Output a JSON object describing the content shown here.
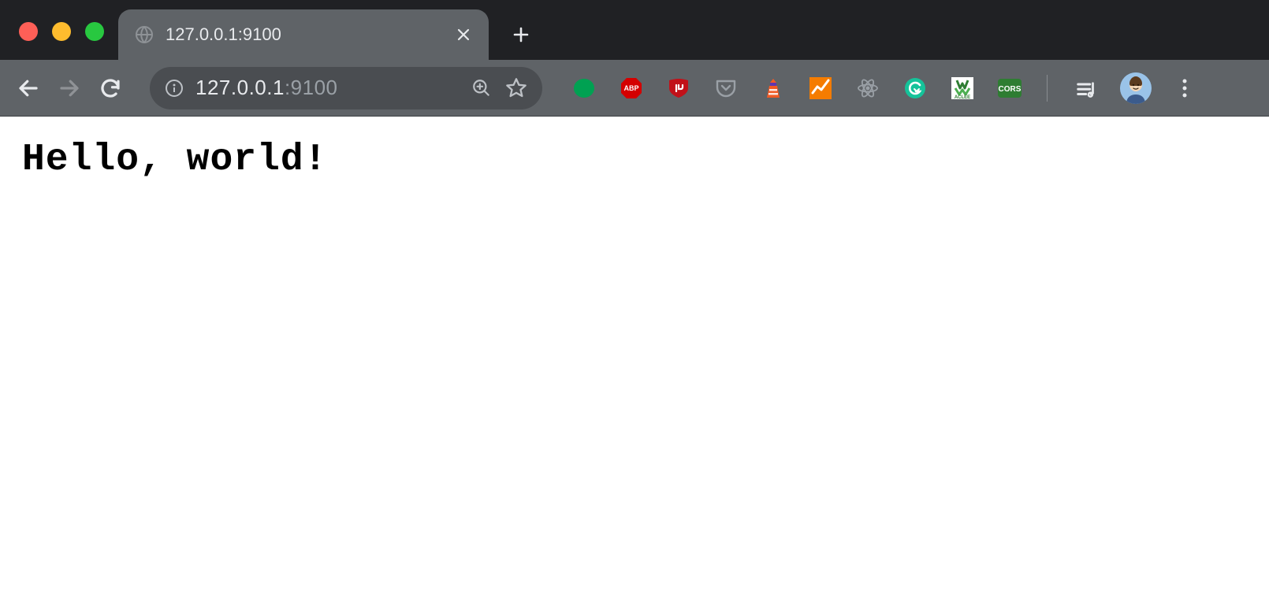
{
  "window": {
    "tab_title": "127.0.0.1:9100"
  },
  "toolbar": {
    "url_host": "127.0.0.1",
    "url_port": ":9100"
  },
  "extensions": [
    {
      "name": "greenlight",
      "color": "#00a152",
      "shape": "circle"
    },
    {
      "name": "abp",
      "label": "ABP",
      "color": "#d40000",
      "shape": "stop"
    },
    {
      "name": "ublock",
      "color": "#c11119",
      "shape": "shield-hand"
    },
    {
      "name": "pocket",
      "color": "#9aa0a6",
      "shape": "pocket"
    },
    {
      "name": "lighthouse",
      "color": "#f15a24",
      "shape": "lighthouse"
    },
    {
      "name": "analytics",
      "color": "#f57c00",
      "shape": "chart"
    },
    {
      "name": "react-devtools",
      "color": "#9aa0a6",
      "shape": "atom"
    },
    {
      "name": "grammarly",
      "color": "#15c39a",
      "shape": "g-circle"
    },
    {
      "name": "aclee",
      "label": "ACLEE",
      "color": "#2e7d32",
      "shape": "square"
    },
    {
      "name": "cors",
      "label": "CORS",
      "color": "#2e7d32",
      "shape": "square-rounded"
    }
  ],
  "page": {
    "body_text": "Hello, world!"
  }
}
